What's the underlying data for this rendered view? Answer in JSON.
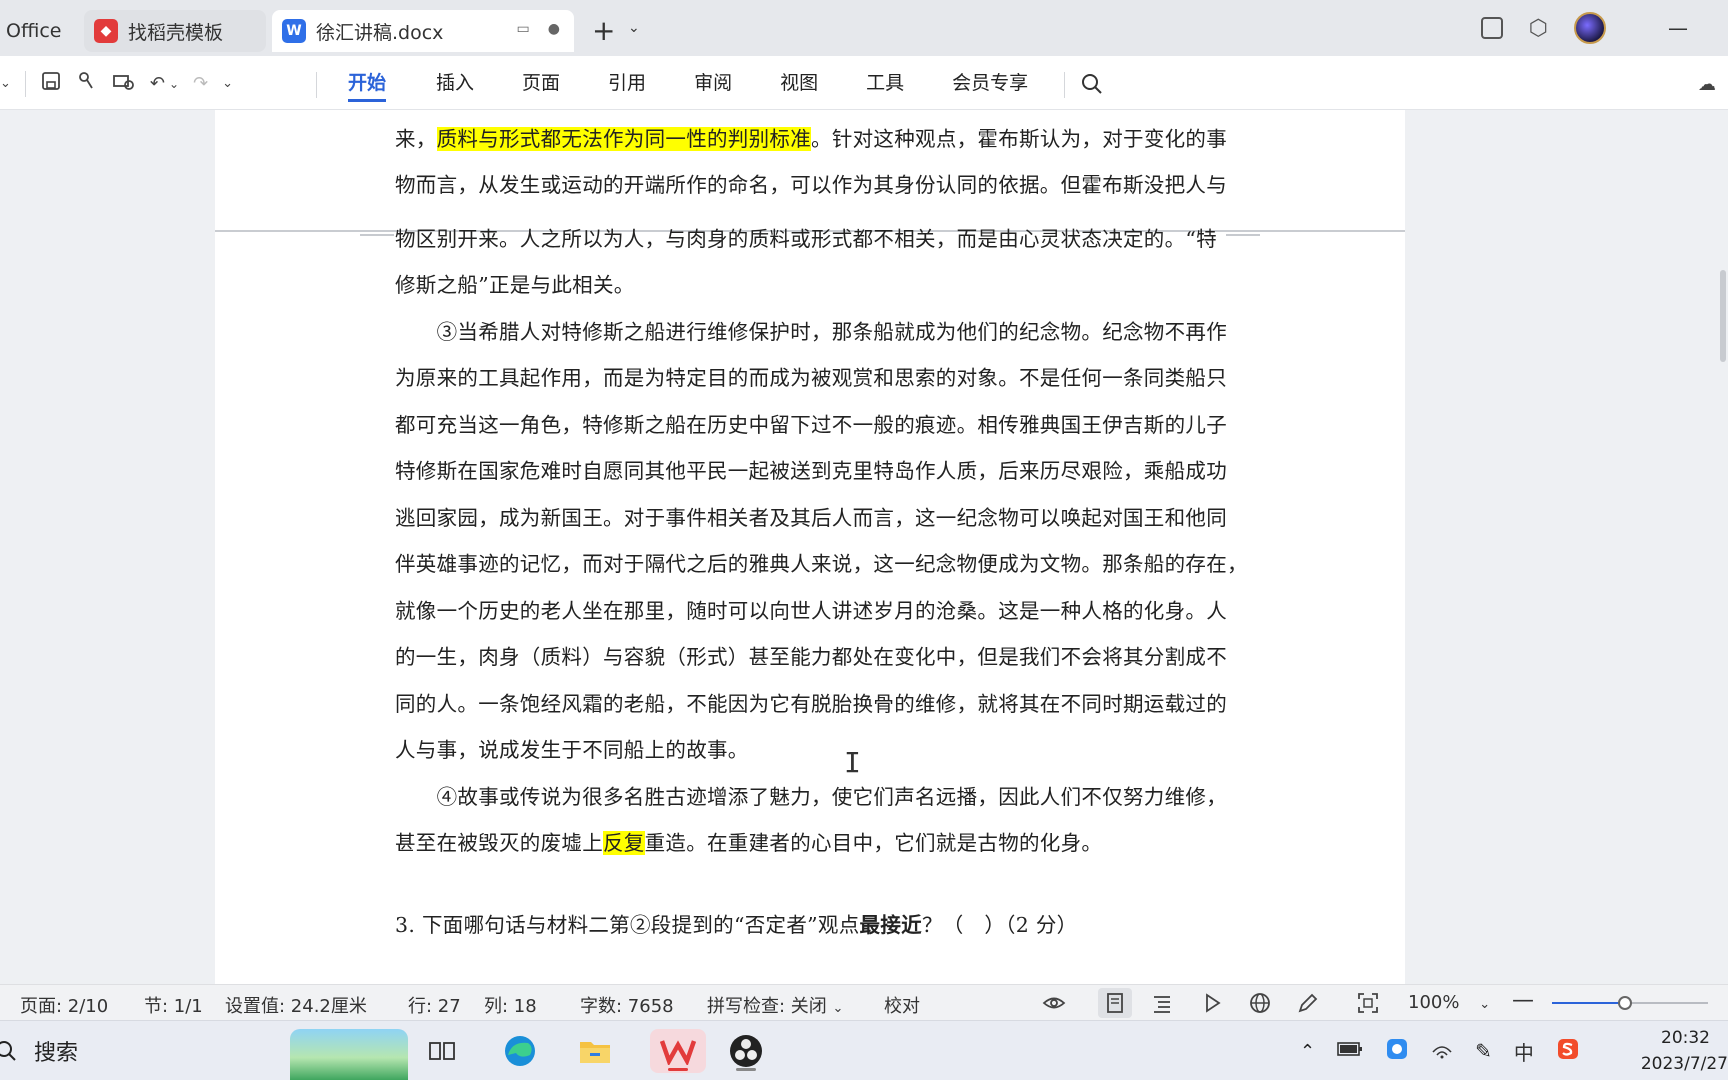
{
  "tabs": [
    {
      "label": "Office"
    },
    {
      "label": "找稻壳模板",
      "icon": "daoke-icon"
    },
    {
      "label": "徐汇讲稿.docx",
      "icon": "word-doc-icon"
    }
  ],
  "ribbon": {
    "tabs": [
      "开始",
      "插入",
      "页面",
      "引用",
      "审阅",
      "视图",
      "工具",
      "会员专享"
    ],
    "active": "开始"
  },
  "document": {
    "top_lines": [
      {
        "pre": "来，",
        "hl": "质料与形式都无法作为同一性的判别标准",
        "post": "。针对这种观点，霍布斯认为，对于变化的事"
      },
      {
        "text": "物而言，从发生或运动的开端所作的命名，可以作为其身份认同的依据。但霍布斯没把人与"
      }
    ],
    "lines": [
      "物区别开来。人之所以为人，与肉身的质料或形式都不相关，而是由心灵状态决定的。“特",
      "修斯之船”正是与此相关。",
      "　　③当希腊人对特修斯之船进行维修保护时，那条船就成为他们的纪念物。纪念物不再作",
      "为原来的工具起作用，而是为特定目的而成为被观赏和思索的对象。不是任何一条同类船只",
      "都可充当这一角色，特修斯之船在历史中留下过不一般的痕迹。相传雅典国王伊吉斯的儿子",
      "特修斯在国家危难时自愿同其他平民一起被送到克里特岛作人质，后来历尽艰险，乘船成功",
      "逃回家园，成为新国王。对于事件相关者及其后人而言，这一纪念物可以唤起对国王和他同",
      "伴英雄事迹的记忆，而对于隔代之后的雅典人来说，这一纪念物便成为文物。那条船的存在，",
      "就像一个历史的老人坐在那里，随时可以向世人讲述岁月的沧桑。这是一种人格的化身。人",
      "的一生，肉身（质料）与容貌（形式）甚至能力都处在变化中，但是我们不会将其分割成不",
      "同的人。一条饱经风霜的老船，不能因为它有脱胎换骨的维修，就将其在不同时期运载过的",
      "人与事，说成发生于不同船上的故事。"
    ],
    "para4": [
      {
        "text": "　　④故事或传说为很多名胜古迹增添了魅力，使它们声名远播，因此人们不仅努力维修，"
      },
      {
        "pre": "甚至在被毁灭的废墟上",
        "hl": "反复",
        "post": "重造。在重建者的心目中，它们就是古物的化身。"
      }
    ],
    "question": {
      "pre": "3. 下面哪句话与材料二第②段提到的“否定者”观点",
      "bold": "最接近",
      "post": "？（　）（2 分）"
    },
    "highlight_color": "#ffff00"
  },
  "status": {
    "page": "页面: 2/10",
    "section": "节: 1/1",
    "setting": "设置值: 24.2厘米",
    "row": "行: 27",
    "col": "列: 18",
    "words": "字数: 7658",
    "spell": "拼写检查: 关闭",
    "proof": "校对",
    "zoom": "100%",
    "zoom_fraction": 0.47
  },
  "taskbar": {
    "search": "搜索",
    "ime": "中",
    "time": "20:32",
    "date": "2023/7/27"
  },
  "colors": {
    "accent": "#2b63d9",
    "wps_red": "#e23b3b"
  }
}
